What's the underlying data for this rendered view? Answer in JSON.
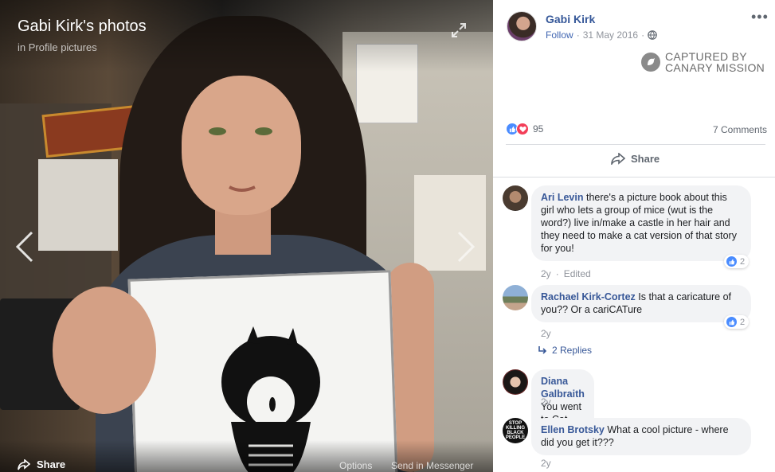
{
  "viewer": {
    "title": "Gabi Kirk's photos",
    "album": "in Profile pictures",
    "share_label": "Share",
    "options_label": "Options",
    "messenger_label": "Send in Messenger"
  },
  "post": {
    "author": "Gabi Kirk",
    "follow_label": "Follow",
    "date": "31 May 2016",
    "separator": "·",
    "reaction_count": "95",
    "comments_count": "7 Comments",
    "share_label": "Share"
  },
  "watermark": {
    "line1": "CAPTURED BY",
    "line2": "CANARY MISSION"
  },
  "comments": [
    {
      "author": "Ari Levin",
      "text": "there's a picture book about this girl who lets a group of mice (wut is the word?) live in/make a castle in her hair and they need to make a cat version of that story for you!",
      "time": "2y",
      "edited": "Edited",
      "reactions": "2"
    },
    {
      "author": "Rachael Kirk-Cortez",
      "text": "Is that a caricature of you?? Or a cariCATure",
      "time": "2y",
      "reactions": "2",
      "replies": "2 Replies"
    },
    {
      "author": "Diana Galbraith",
      "text": "You went to Cat Town!",
      "time": "2y"
    },
    {
      "author": "Ellen Brotsky",
      "text": "What a cool picture - where did you get it???",
      "time": "2y",
      "avatar_text": "STOP KILLING BLACK PEOPLE"
    }
  ],
  "colors": {
    "link_blue": "#385898",
    "like_blue": "#4a8cff",
    "love_red": "#f33e58",
    "bubble_gray": "#f2f3f5"
  },
  "icons": [
    "expand-icon",
    "chevron-left-icon",
    "chevron-right-icon",
    "share-icon",
    "globe-icon",
    "more-icon",
    "like-icon",
    "love-icon",
    "reply-arrow-icon"
  ]
}
